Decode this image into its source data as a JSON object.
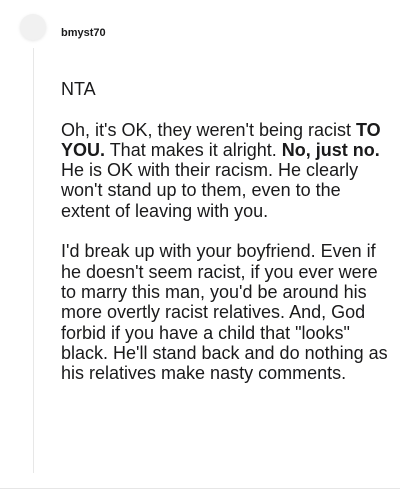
{
  "comment": {
    "username": "bmyst70",
    "paragraphs": {
      "p1": "NTA",
      "p2": {
        "t1": "Oh, it's OK, they weren't being racist ",
        "b1": "TO YOU.",
        "t2": " That makes it alright. ",
        "b2": "No, just no.",
        "t3": " He is OK with their racism. He clearly won't stand up to them, even to the extent of leaving with you."
      },
      "p3": "I'd break up with your boyfriend. Even if he doesn't seem racist, if you ever were to marry this man, you'd be around his more overtly racist relatives. And, God forbid if you have a child that \"looks\" black. He'll stand back and do nothing as his relatives make nasty comments."
    }
  },
  "colors": {
    "text": "#1a1a1b",
    "avatar": "#f1f1f1",
    "thread_line": "#e7e7e7"
  }
}
